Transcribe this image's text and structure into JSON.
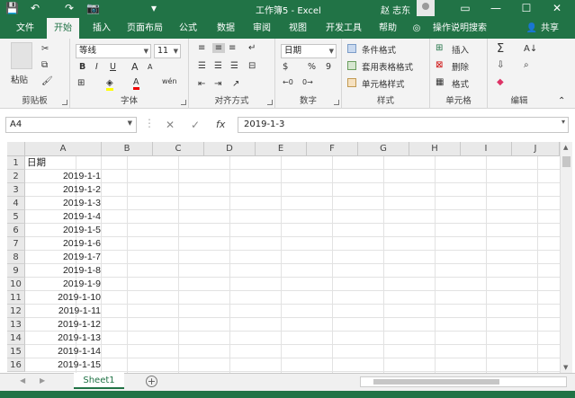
{
  "window": {
    "title": "工作簿5 - Excel",
    "user": "赵 志东",
    "min": "—",
    "restore": "☐",
    "close": "✕"
  },
  "qat": {
    "save": "💾",
    "undo": "↶",
    "redo": "↷",
    "camera": "📷",
    "more": "▾"
  },
  "tabs": [
    "文件",
    "开始",
    "插入",
    "页面布局",
    "公式",
    "数据",
    "审阅",
    "视图",
    "开发工具",
    "帮助"
  ],
  "active_tab": "开始",
  "tell_me": "操作说明搜索",
  "share": "共享",
  "ribbon": {
    "clipboard": {
      "label": "剪贴板",
      "paste": "粘贴"
    },
    "font": {
      "label": "字体",
      "font_name": "等线",
      "font_size": "11",
      "bold": "B",
      "italic": "I",
      "underline": "U",
      "grow": "A",
      "shrink": "A",
      "font_color": "A",
      "wen": "wén"
    },
    "alignment": {
      "label": "对齐方式"
    },
    "number": {
      "label": "数字",
      "format": "日期",
      "percent": "%",
      "comma": "9"
    },
    "styles": {
      "label": "样式",
      "conditional": "条件格式",
      "table": "套用表格格式",
      "cell_styles": "单元格样式"
    },
    "cells": {
      "label": "单元格",
      "insert": "插入",
      "delete": "删除",
      "format": "格式"
    },
    "editing": {
      "label": "编辑",
      "sum": "Σ"
    }
  },
  "formula_bar": {
    "name_box": "A4",
    "fx": "fx",
    "cancel": "✕",
    "enter": "✓",
    "value": "2019-1-3"
  },
  "columns": [
    "A",
    "B",
    "C",
    "D",
    "E",
    "F",
    "G",
    "H",
    "I",
    "J"
  ],
  "rows": [
    "1",
    "2",
    "3",
    "4",
    "5",
    "6",
    "7",
    "8",
    "9",
    "10",
    "11",
    "12",
    "13",
    "14",
    "15",
    "16"
  ],
  "cells": {
    "header": "日期",
    "dates": [
      "2019-1-1",
      "2019-1-2",
      "2019-1-3",
      "2019-1-4",
      "2019-1-5",
      "2019-1-6",
      "2019-1-7",
      "2019-1-8",
      "2019-1-9",
      "2019-1-10",
      "2019-1-11",
      "2019-1-12",
      "2019-1-13",
      "2019-1-14",
      "2019-1-15"
    ]
  },
  "sheets": [
    "Sheet1"
  ],
  "colors": {
    "accent": "#217346"
  }
}
